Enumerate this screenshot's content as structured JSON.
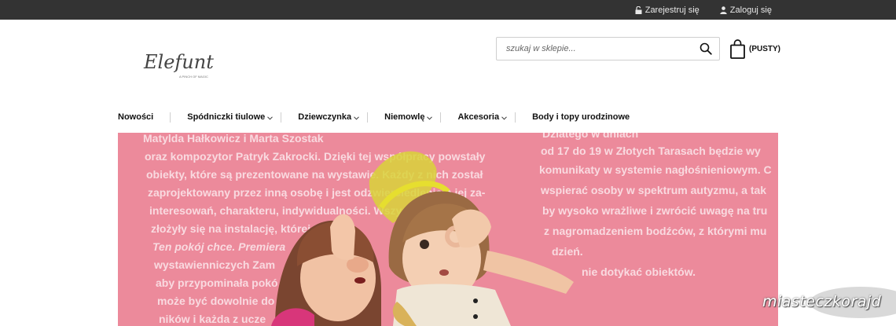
{
  "topbar": {
    "register_label": "Zarejestruj się",
    "login_label": "Zaloguj się"
  },
  "logo": {
    "text": "Elefunt",
    "tagline": "A PINCH OF MAGIC"
  },
  "search": {
    "placeholder": "szukaj w sklepie..."
  },
  "cart": {
    "label": "(PUSTY)"
  },
  "nav": {
    "items": [
      {
        "label": "Nowości"
      },
      {
        "label": "Spódniczki tiulowe"
      },
      {
        "label": "Dziewczynka"
      },
      {
        "label": "Niemowlę"
      },
      {
        "label": "Akcesoria"
      },
      {
        "label": "Body i topy urodzinowe"
      }
    ]
  },
  "hero": {
    "left_lines": [
      "Matylda Hałkowicz i Marta Szostak",
      "oraz kompozytor Patryk Zakrocki. Dzięki tej współpracy powstały",
      "obiekty, które są prezentowane na wystawie. Każdy z nich został",
      "zaprojektowany przez inną osobę i jest odzwierciedleniem jej za-",
      "interesowań, charakteru, indywidualności. Wszystkie",
      "złożyły się na instalację, której tytuł:",
      "Ten pokój chce. Premiera",
      "wystawienniczych Zam",
      "aby przypominała pokó",
      "może być dowolnie do",
      "ników i każda z ucze"
    ],
    "right_lines": [
      "Dziatego w dniach",
      "od 17 do 19 w Złotych Tarasach będzie wy",
      "komunikaty w systemie nagłośnieniowym. C",
      "wspierać osoby w spektrum autyzmu, a tak",
      "by wysoko wrażliwe i zwrócić uwagę na tru",
      "z nagromadzeniem bodźców, z którymi mu",
      "dzień.",
      "nie dotykać obiektów."
    ]
  },
  "watermark": {
    "text": "miasteczkorajd"
  },
  "colors": {
    "topbar_bg": "#333333",
    "hero_bg": "#ec8a9b",
    "text_dark": "#111111"
  }
}
